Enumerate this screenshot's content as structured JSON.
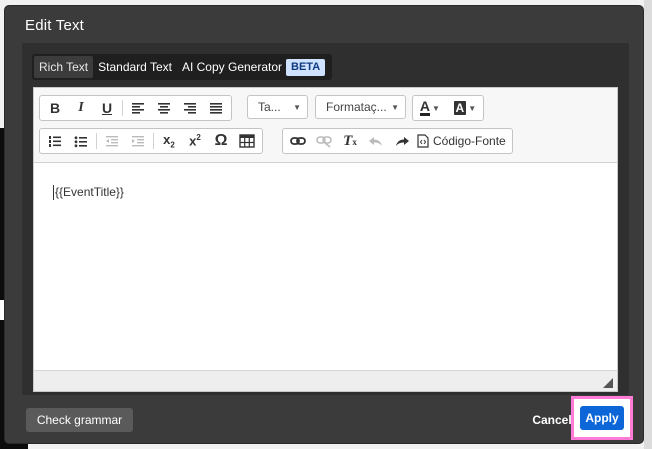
{
  "dialog": {
    "title": "Edit Text",
    "tabs": [
      {
        "label": "Rich Text",
        "active": true
      },
      {
        "label": "Standard Text",
        "active": false
      },
      {
        "label": "AI Copy Generator",
        "active": false,
        "badge": "BETA"
      }
    ]
  },
  "toolbar": {
    "size_combo": "Ta...",
    "format_combo": "Formataç...",
    "text_color_glyph": "A",
    "bg_color_glyph": "A",
    "bold": "B",
    "italic": "I",
    "underline": "U",
    "omega": "Ω",
    "source_label": "Código-Fonte"
  },
  "editor": {
    "content": "{{EventTitle}}"
  },
  "footer": {
    "check_grammar": "Check grammar",
    "cancel": "Cancel",
    "apply": "Apply"
  },
  "colors": {
    "modal_bg": "#3b3b3b",
    "apply_bg": "#0c66d8",
    "highlight": "#ff7bd6",
    "beta_bg": "#cfe2ff"
  }
}
